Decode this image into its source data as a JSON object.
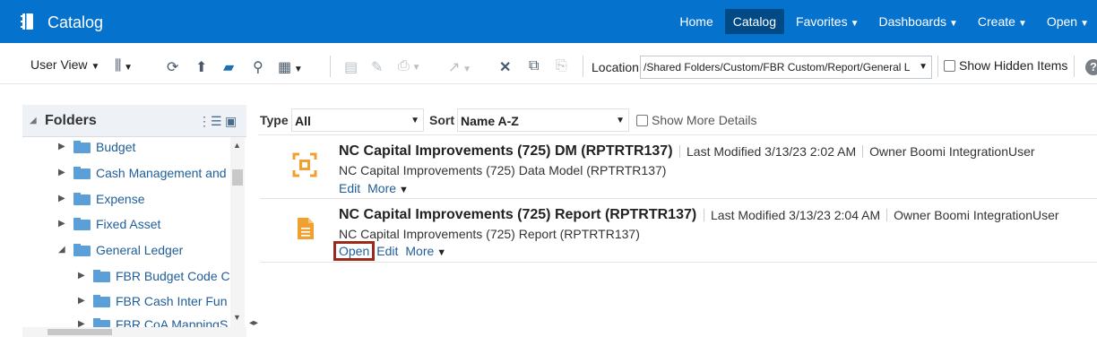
{
  "header": {
    "app_title": "Catalog",
    "nav": [
      "Home",
      "Catalog",
      "Favorites",
      "Dashboards",
      "Create",
      "Open"
    ],
    "active": "Catalog"
  },
  "toolbar": {
    "user_view": "User View",
    "location_label": "Location",
    "location_value": "/Shared Folders/Custom/FBR Custom/Report/General L",
    "show_hidden": "Show Hidden Items"
  },
  "folders": {
    "title": "Folders",
    "items": [
      {
        "label": "Budget",
        "expanded": false,
        "level": 0
      },
      {
        "label": "Cash Management and",
        "expanded": false,
        "level": 0
      },
      {
        "label": "Expense",
        "expanded": false,
        "level": 0
      },
      {
        "label": "Fixed Asset",
        "expanded": false,
        "level": 0
      },
      {
        "label": "General Ledger",
        "expanded": true,
        "level": 0
      },
      {
        "label": "FBR Budget Code C",
        "expanded": false,
        "level": 1
      },
      {
        "label": "FBR Cash Inter Fun",
        "expanded": false,
        "level": 1
      },
      {
        "label": "FBR CoA MappingS",
        "expanded": false,
        "level": 1
      }
    ]
  },
  "filters": {
    "type_label": "Type",
    "type_value": "All",
    "sort_label": "Sort",
    "sort_value": "Name A-Z",
    "more_details": "Show More Details"
  },
  "items": [
    {
      "title": "NC Capital Improvements (725) DM (RPTRTR137)",
      "last_modified": "Last Modified 3/13/23 2:02 AM",
      "owner": "Owner Boomi IntegrationUser",
      "description": "NC Capital Improvements (725) Data Model (RPTRTR137)",
      "actions": [
        "Edit",
        "More"
      ]
    },
    {
      "title": "NC Capital Improvements (725) Report (RPTRTR137)",
      "last_modified": "Last Modified 3/13/23 2:04 AM",
      "owner": "Owner Boomi IntegrationUser",
      "description": "NC Capital Improvements (725) Report (RPTRTR137)",
      "actions": [
        "Open",
        "Edit",
        "More"
      ]
    }
  ]
}
